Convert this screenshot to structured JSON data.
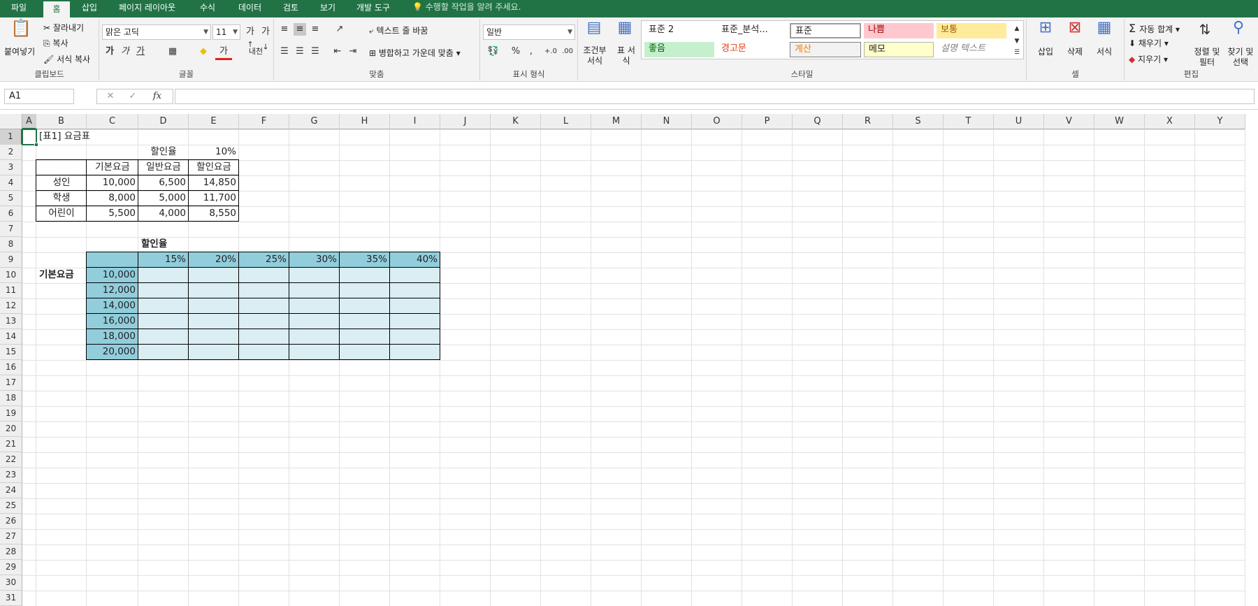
{
  "menu": {
    "tabs": [
      "파일",
      "홈",
      "삽입",
      "페이지 레이아웃",
      "수식",
      "데이터",
      "검토",
      "보기",
      "개발 도구"
    ],
    "tell_me": "수행할 작업을 알려 주세요."
  },
  "ribbon": {
    "clipboard": {
      "paste": "붙여넣기",
      "cut": "잘라내기",
      "copy": "복사",
      "format_painter": "서식 복사",
      "label": "클립보드"
    },
    "font": {
      "name": "맑은 고딕",
      "size": "11",
      "label": "글꼴",
      "bold": "가",
      "italic": "가",
      "underline": "가",
      "phonetic": "내천"
    },
    "alignment": {
      "wrap": "텍스트 줄 바꿈",
      "merge": "병합하고 가운데 맞춤",
      "label": "맞춤"
    },
    "number": {
      "format": "일반",
      "label": "표시 형식"
    },
    "styles": {
      "cond": "조건부 서식",
      "table": "표 서식",
      "cells": [
        [
          "표준 2",
          "표준_분석...",
          "표준",
          "나쁨",
          "보통"
        ],
        [
          "좋음",
          "경고문",
          "계산",
          "메모",
          "설명 텍스트"
        ]
      ],
      "label": "스타일"
    },
    "cells": {
      "insert": "삽입",
      "delete": "삭제",
      "format": "서식",
      "label": "셀"
    },
    "editing": {
      "autosum": "자동 합계",
      "fill": "채우기",
      "clear": "지우기",
      "sort": "정렬 및 필터",
      "find": "찾기 및 선택",
      "label": "편집"
    }
  },
  "formula_bar": {
    "name_box": "A1",
    "fx": "fx",
    "content": ""
  },
  "columns": [
    "A",
    "B",
    "C",
    "D",
    "E",
    "F",
    "G",
    "H",
    "I",
    "J",
    "K",
    "L",
    "M",
    "N",
    "O",
    "P",
    "Q",
    "R",
    "S",
    "T",
    "U",
    "V",
    "W",
    "X",
    "Y"
  ],
  "rows": [
    "1",
    "2",
    "3",
    "4",
    "5",
    "6",
    "7",
    "8",
    "9",
    "10",
    "11",
    "12",
    "13",
    "14",
    "15",
    "16",
    "17",
    "18",
    "19",
    "20",
    "21",
    "22",
    "23",
    "24",
    "25",
    "26",
    "27",
    "28",
    "29",
    "30",
    "31"
  ],
  "cells": {
    "B1": "[표1] 요금표",
    "D2": "할인율",
    "E2": "10%",
    "C3": "기본요금",
    "D3": "일반요금",
    "E3": "할인요금",
    "B4": "성인",
    "C4": "10,000",
    "D4": "6,500",
    "E4": "14,850",
    "B5": "학생",
    "C5": "8,000",
    "D5": "5,000",
    "E5": "11,700",
    "B6": "어린이",
    "C6": "5,500",
    "D6": "4,000",
    "E6": "8,550",
    "D8": "할인율",
    "B10": "기본요금",
    "rates": [
      "15%",
      "20%",
      "25%",
      "30%",
      "35%",
      "40%"
    ],
    "bases": [
      "10,000",
      "12,000",
      "14,000",
      "16,000",
      "18,000",
      "20,000"
    ]
  },
  "colors": {
    "excel_green": "#217346",
    "header_blue": "#92cddc",
    "body_blue": "#daeef3"
  }
}
